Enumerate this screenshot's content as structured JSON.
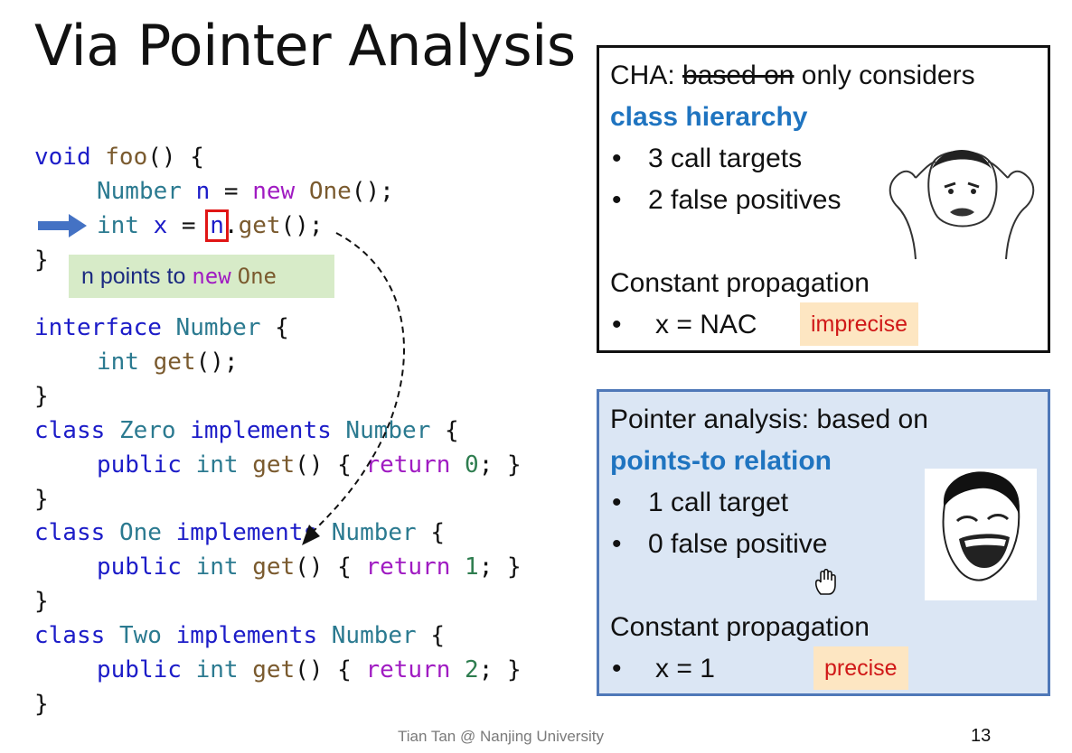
{
  "slide": {
    "title": "Via Pointer Analysis",
    "footer": "Tian Tan @ Nanjing University",
    "page_number": "13"
  },
  "code": {
    "l1": {
      "kw": "void",
      "fn": "foo",
      "rest": "() {"
    },
    "l2": {
      "type": "Number",
      "var": "n",
      "eq": " = ",
      "new": "new",
      "cls": "One",
      "rest": "();"
    },
    "l3": {
      "type": "int",
      "var": "x",
      "eq": " = ",
      "ref": "n",
      "dot": ".",
      "fn": "get",
      "rest": "();"
    },
    "l4": "}",
    "l5": {
      "kw": "interface",
      "name": "Number",
      "rest": " {"
    },
    "l6": {
      "type": "int",
      "fn": "get",
      "rest": "();"
    },
    "l7": "}",
    "cls_kw": "class",
    "impl_kw": "implements",
    "iface": "Number",
    "pub_kw": "public",
    "int_kw": "int",
    "get_fn": "get",
    "ret_kw": "return",
    "classes": [
      {
        "name": "Zero",
        "value": "0"
      },
      {
        "name": "One",
        "value": "1"
      },
      {
        "name": "Two",
        "value": "2"
      }
    ],
    "close": "}"
  },
  "note": {
    "prefix": "n points to ",
    "new": "new",
    "cls": "One"
  },
  "cha_box": {
    "label_prefix": "CHA: ",
    "struck": "based on",
    "label_suffix": " only considers",
    "emph": "class hierarchy",
    "bullets": [
      "3 call targets",
      "2 false positives"
    ],
    "cp_title": "Constant propagation",
    "cp_value": "x = NAC",
    "tag": "imprecise"
  },
  "pta_box": {
    "label": "Pointer analysis: based on",
    "emph": "points-to relation",
    "bullets": [
      "1 call target",
      "0 false positive"
    ],
    "cp_title": "Constant propagation",
    "cp_value": "x = 1",
    "tag": "precise"
  },
  "bullet_glyph": "•"
}
